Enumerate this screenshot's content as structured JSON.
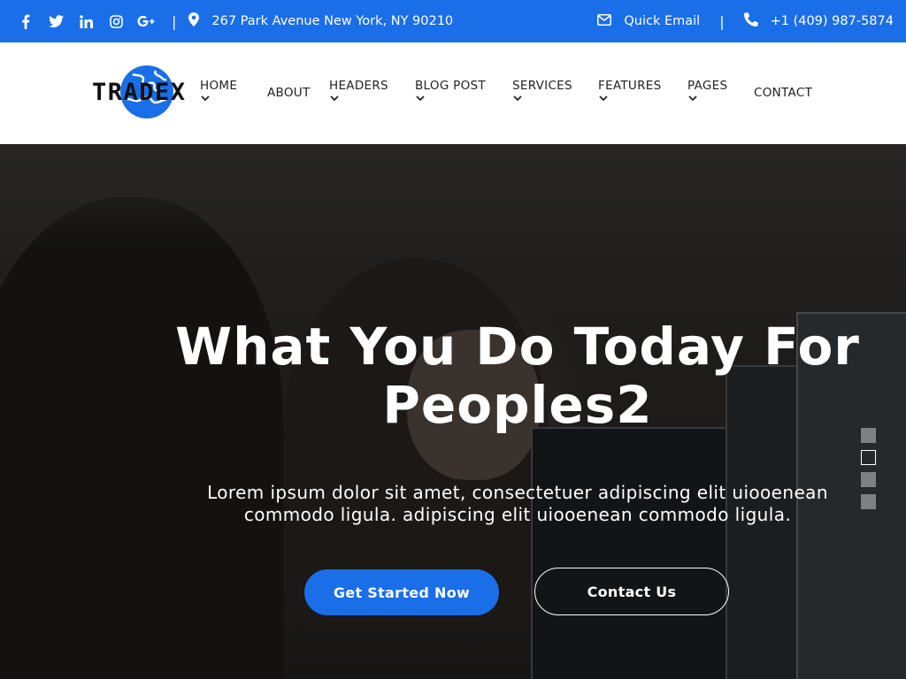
{
  "topbar": {
    "social_icons": [
      "facebook-icon",
      "twitter-icon",
      "linkedin-icon",
      "instagram-icon",
      "google-plus-icon"
    ],
    "separator": "|",
    "address": "267 Park Avenue New York, NY 90210",
    "email_label": "Quick Email",
    "phone": "+1 (409) 987-5874",
    "bg_color": "#1a6ee8"
  },
  "header": {
    "logo_text": "TRADEX",
    "nav": [
      {
        "label": "HOME",
        "dropdown": true
      },
      {
        "label": "ABOUT",
        "dropdown": false
      },
      {
        "label": "HEADERS",
        "dropdown": true
      },
      {
        "label": "BLOG POST",
        "dropdown": true
      },
      {
        "label": "SERVICES",
        "dropdown": true
      },
      {
        "label": "FEATURES",
        "dropdown": true
      },
      {
        "label": "PAGES",
        "dropdown": true
      },
      {
        "label": "CONTACT",
        "dropdown": false
      }
    ]
  },
  "hero": {
    "title": "What You Do Today For Peoples2",
    "subtitle": "Lorem ipsum dolor sit amet, consectetuer adipiscing elit uiooenean commodo ligula. adipiscing elit uiooenean commodo ligula.",
    "primary_button": "Get Started Now",
    "secondary_button": "Contact Us",
    "slides_count": 4,
    "active_slide": 2,
    "accent_color": "#1a6ee8"
  }
}
